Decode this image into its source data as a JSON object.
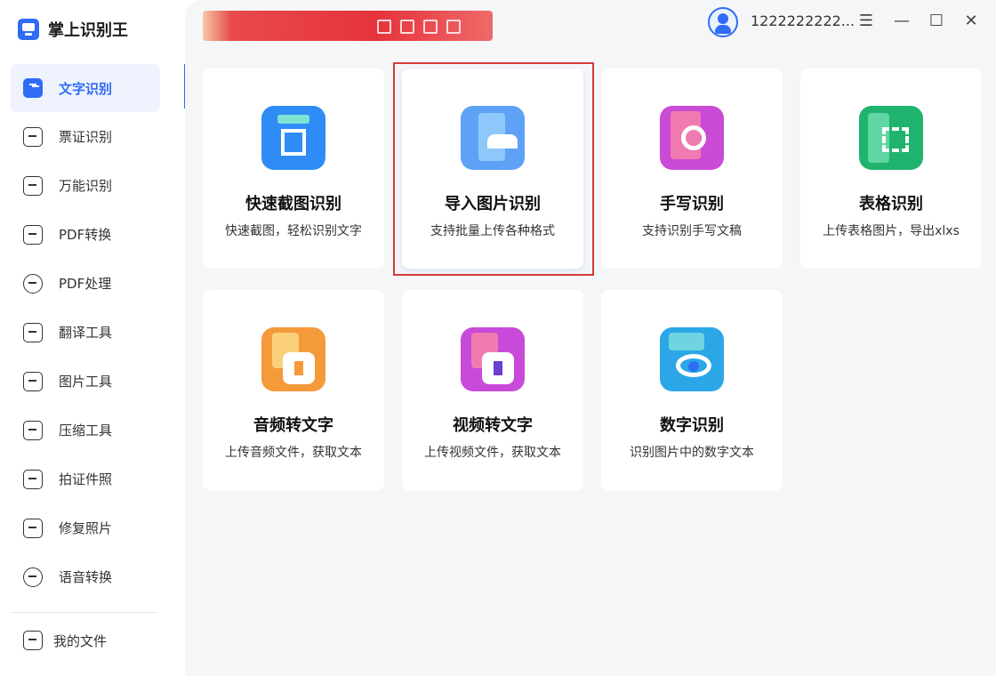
{
  "app": {
    "name": "掌上识别王"
  },
  "header": {
    "user_name": "1222222222...",
    "window_buttons": {
      "menu": "☰",
      "minimize": "—",
      "maximize": "☐",
      "close": "✕"
    }
  },
  "sidebar": {
    "items": [
      {
        "label": "文字识别",
        "icon": "text-recognition-icon",
        "active": true
      },
      {
        "label": "票证识别",
        "icon": "ticket-icon"
      },
      {
        "label": "万能识别",
        "icon": "universal-scan-icon"
      },
      {
        "label": "PDF转换",
        "icon": "pdf-convert-icon"
      },
      {
        "label": "PDF处理",
        "icon": "pdf-process-icon"
      },
      {
        "label": "翻译工具",
        "icon": "translate-icon"
      },
      {
        "label": "图片工具",
        "icon": "image-tool-icon"
      },
      {
        "label": "压缩工具",
        "icon": "compress-icon"
      },
      {
        "label": "拍证件照",
        "icon": "id-photo-icon"
      },
      {
        "label": "修复照片",
        "icon": "photo-repair-icon"
      },
      {
        "label": "语音转换",
        "icon": "voice-convert-icon"
      }
    ],
    "footer": {
      "label": "我的文件",
      "icon": "my-files-icon"
    }
  },
  "cards": [
    {
      "title": "快速截图识别",
      "desc": "快速截图，轻松识别文字",
      "icon": "screenshot-crop-icon",
      "color": "#2f8cf6"
    },
    {
      "title": "导入图片识别",
      "desc": "支持批量上传各种格式",
      "icon": "import-image-icon",
      "color": "#5ea2f7",
      "selected": true
    },
    {
      "title": "手写识别",
      "desc": "支持识别手写文稿",
      "icon": "handwriting-icon",
      "color": "#c94bd6"
    },
    {
      "title": "表格识别",
      "desc": "上传表格图片，导出xlxs",
      "icon": "table-scan-icon",
      "color": "#1fb36e"
    },
    {
      "title": "音频转文字",
      "desc": "上传音频文件，获取文本",
      "icon": "audio-to-text-icon",
      "color": "#f49a3b"
    },
    {
      "title": "视频转文字",
      "desc": "上传视频文件，获取文本",
      "icon": "video-to-text-icon",
      "color": "#c84ad8"
    },
    {
      "title": "数字识别",
      "desc": "识别图片中的数字文本",
      "icon": "number-recognition-icon",
      "color": "#2ba7e8"
    }
  ],
  "colors": {
    "accent": "#2f6cf6",
    "highlight": "#d63a3a",
    "banner": "#e5333c"
  }
}
